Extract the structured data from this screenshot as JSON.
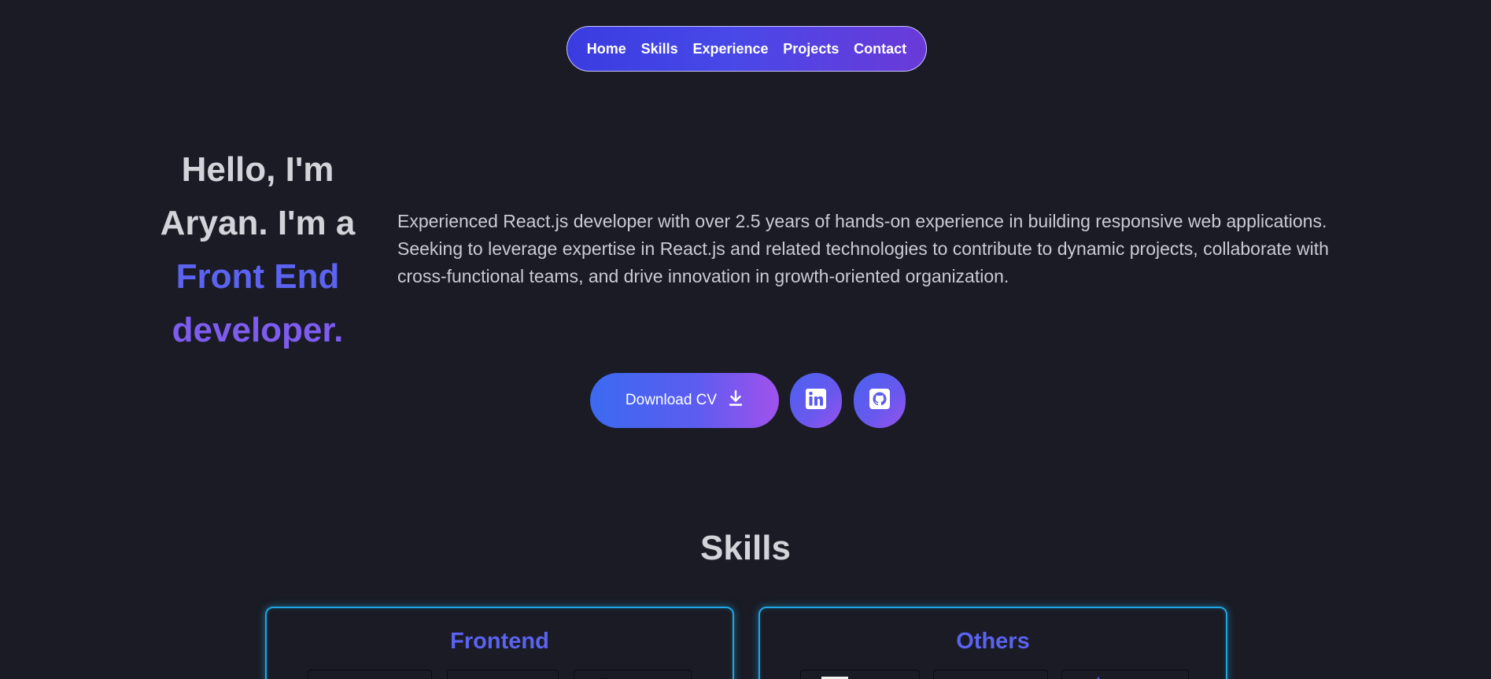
{
  "nav": {
    "items": [
      {
        "label": "Home"
      },
      {
        "label": "Skills"
      },
      {
        "label": "Experience"
      },
      {
        "label": "Projects"
      },
      {
        "label": "Contact"
      }
    ]
  },
  "hero": {
    "line1": "Hello, I'm",
    "line2": "Aryan. I'm a",
    "line3": "Front End",
    "line4": "developer.",
    "description": "Experienced React.js developer with over 2.5 years of hands-on experience in building responsive web applications. Seeking to leverage expertise in React.js and related technologies to contribute to dynamic projects, collaborate with cross-functional teams, and drive innovation in growth-oriented organization."
  },
  "actions": {
    "download_cv_label": "Download CV",
    "download_icon": "download-icon",
    "linkedin_icon": "linkedin-icon",
    "github_icon": "github-icon"
  },
  "skills": {
    "title": "Skills",
    "cards": [
      {
        "title": "Frontend"
      },
      {
        "title": "Others"
      }
    ]
  },
  "colors": {
    "background": "#1a1b24",
    "accent_blue": "#5b63f0",
    "accent_purple": "#7e5cf0",
    "card_border": "#1fa6e6"
  }
}
